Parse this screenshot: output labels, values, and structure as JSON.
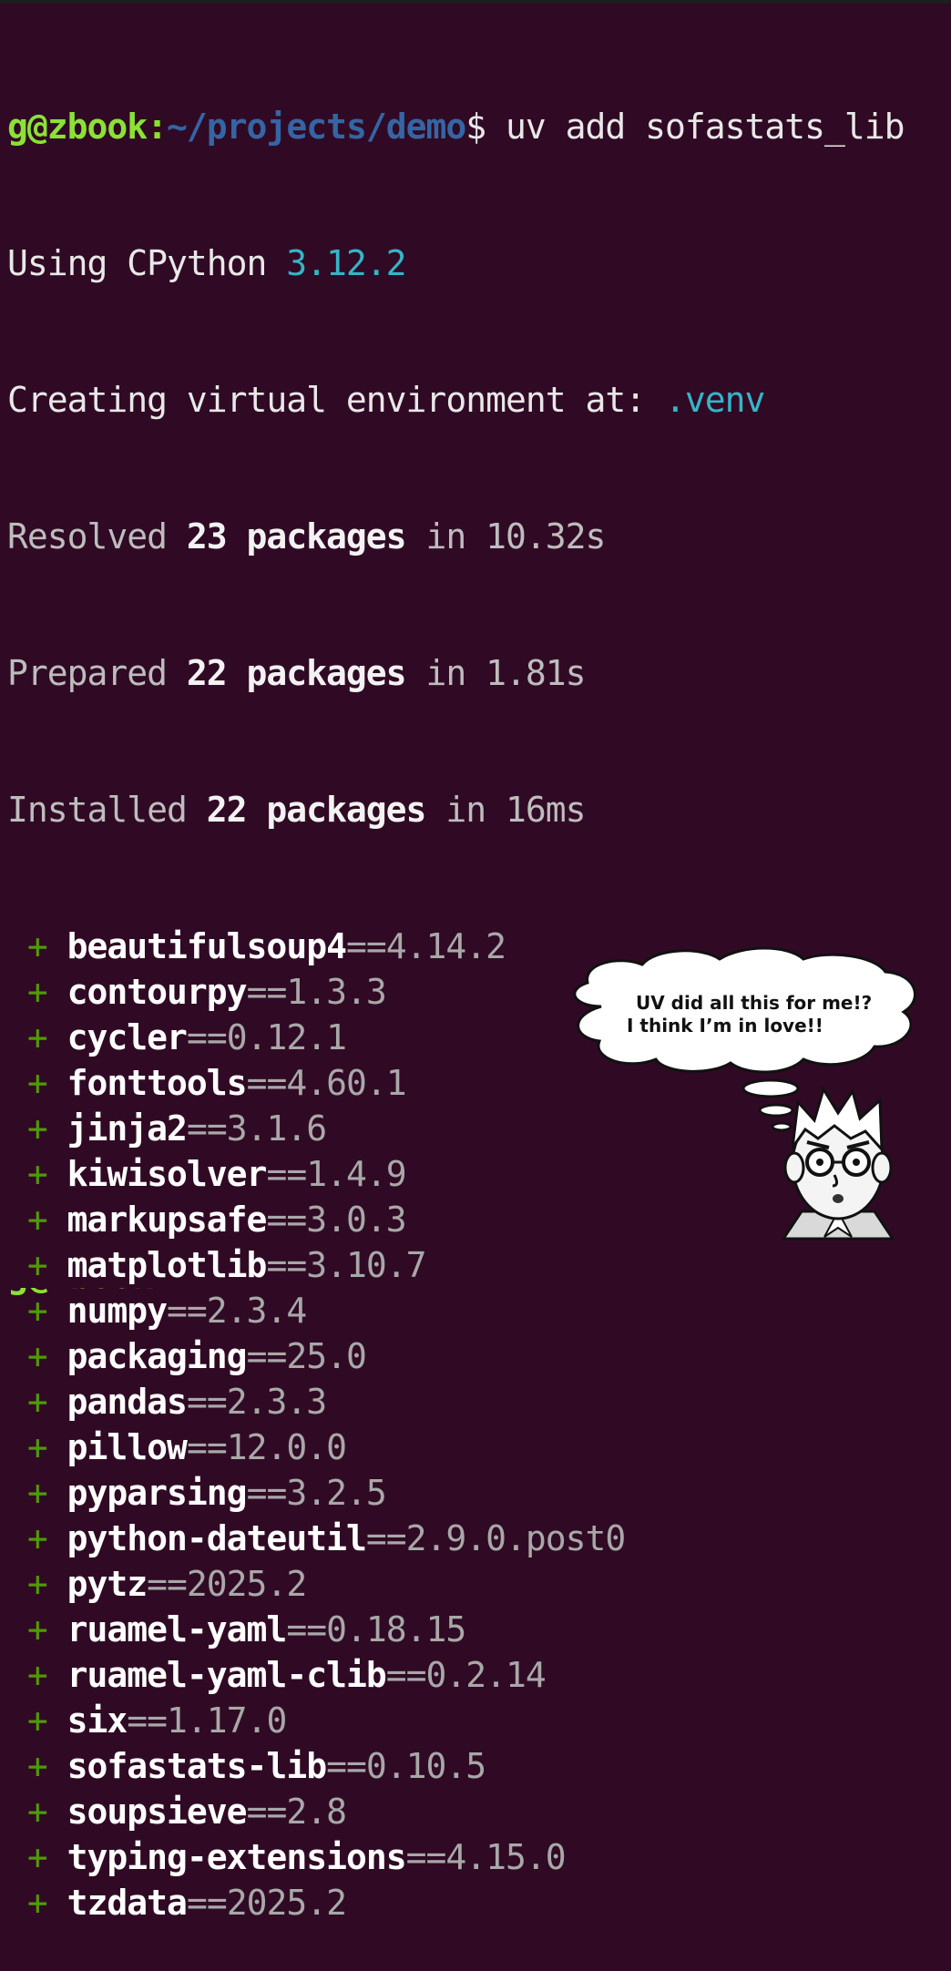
{
  "terminal": {
    "prompt_user_host": "g@zbook",
    "prompt_sep": ":",
    "prompt_path": "~/projects/demo",
    "prompt_dollar": "$",
    "command": " uv add sofastats_lib",
    "python_prefix": "Using CPython ",
    "python_version": "3.12.2",
    "venv_prefix": "Creating virtual environment at: ",
    "venv_path": ".venv",
    "resolved": {
      "label": "Resolved ",
      "count": "23 packages",
      "rest": " in 10.32s"
    },
    "prepared": {
      "label": "Prepared ",
      "count": "22 packages",
      "rest": " in 1.81s"
    },
    "installed": {
      "label": "Installed ",
      "count": "22 packages",
      "rest": " in 16ms"
    },
    "packages": [
      {
        "name": "beautifulsoup4",
        "version": "==4.14.2"
      },
      {
        "name": "contourpy",
        "version": "==1.3.3"
      },
      {
        "name": "cycler",
        "version": "==0.12.1"
      },
      {
        "name": "fonttools",
        "version": "==4.60.1"
      },
      {
        "name": "jinja2",
        "version": "==3.1.6"
      },
      {
        "name": "kiwisolver",
        "version": "==1.4.9"
      },
      {
        "name": "markupsafe",
        "version": "==3.0.3"
      },
      {
        "name": "matplotlib",
        "version": "==3.10.7"
      },
      {
        "name": "numpy",
        "version": "==2.3.4"
      },
      {
        "name": "packaging",
        "version": "==25.0"
      },
      {
        "name": "pandas",
        "version": "==2.3.3"
      },
      {
        "name": "pillow",
        "version": "==12.0.0"
      },
      {
        "name": "pyparsing",
        "version": "==3.2.5"
      },
      {
        "name": "python-dateutil",
        "version": "==2.9.0.post0"
      },
      {
        "name": "pytz",
        "version": "==2025.2"
      },
      {
        "name": "ruamel-yaml",
        "version": "==0.18.15"
      },
      {
        "name": "ruamel-yaml-clib",
        "version": "==0.2.14"
      },
      {
        "name": "six",
        "version": "==1.17.0"
      },
      {
        "name": "sofastats-lib",
        "version": "==0.10.5"
      },
      {
        "name": "soupsieve",
        "version": "==2.8"
      },
      {
        "name": "typing-extensions",
        "version": "==4.15.0"
      },
      {
        "name": "tzdata",
        "version": "==2025.2"
      }
    ],
    "plus_glyph": "+ "
  },
  "speech_bubble": {
    "line1": "UV did all this for me!?",
    "line2": "I think I’m in love!!"
  },
  "colors": {
    "background": "#300a24",
    "prompt_user": "#8ae234",
    "prompt_path": "#3465a4",
    "accent_cyan": "#34b5c8"
  }
}
